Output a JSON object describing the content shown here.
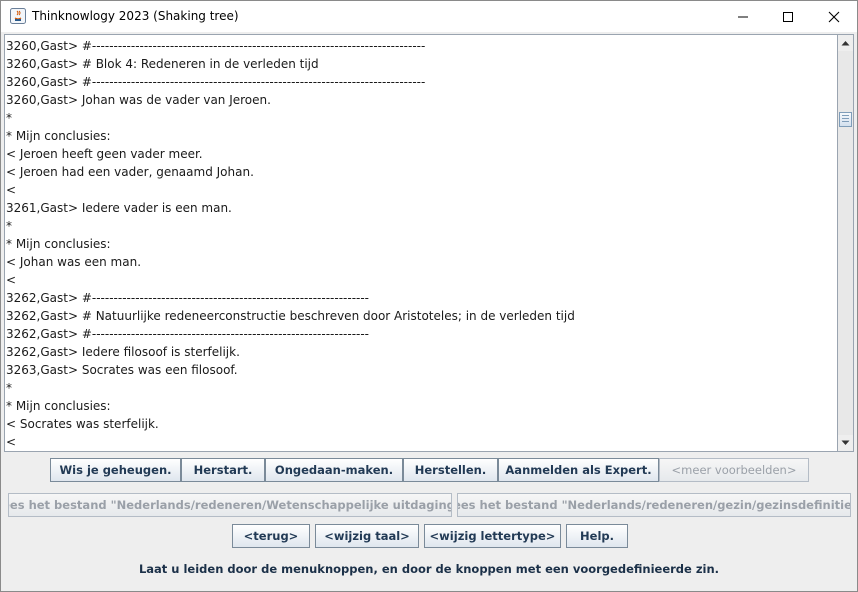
{
  "window": {
    "title": "Thinknowlogy 2023 (Shaking tree)",
    "controls": {
      "minimize": "minimize",
      "maximize": "maximize",
      "close": "close"
    }
  },
  "output_lines": [
    "3260,Gast> #-----------------------------------------------------------------------------",
    "3260,Gast> # Blok 4: Redeneren in de verleden tijd",
    "3260,Gast> #-----------------------------------------------------------------------------",
    "3260,Gast> Johan was de vader van Jeroen.",
    "*",
    "* Mijn conclusies:",
    "< Jeroen heeft geen vader meer.",
    "< Jeroen had een vader, genaamd Johan.",
    "<",
    "3261,Gast> Iedere vader is een man.",
    "*",
    "* Mijn conclusies:",
    "< Johan was een man.",
    "<",
    "3262,Gast> #----------------------------------------------------------------",
    "3262,Gast> # Natuurlijke redeneerconstructie beschreven door Aristoteles; in de verleden tijd",
    "3262,Gast> #----------------------------------------------------------------",
    "3262,Gast> Iedere filosoof is sterfelijk.",
    "3263,Gast> Socrates was een filosoof.",
    "*",
    "* Mijn conclusies:",
    "< Socrates was sterfelijk.",
    "<"
  ],
  "buttons": {
    "row1": [
      "Wis je geheugen.",
      "Herstart.",
      "Ongedaan-maken.",
      "Herstellen.",
      "Aanmelden als Expert.",
      "<meer voorbeelden>"
    ],
    "row2": [
      "Lees het bestand \"Nederlands/redeneren/Wetenschappelijke uitdaging\".",
      "Lees het bestand \"Nederlands/redeneren/gezin/gezinsdefinitie\"."
    ],
    "row3": [
      "<terug>",
      "<wijzig taal>",
      "<wijzig lettertype>",
      "Help."
    ]
  },
  "status_text": "Laat u leiden door de menuknoppen, en door de knoppen met een voorgedefinieerde zin.",
  "colors": {
    "button_text": "#223a55",
    "disabled_text": "#9aa0a8",
    "background": "#eeeeee"
  }
}
